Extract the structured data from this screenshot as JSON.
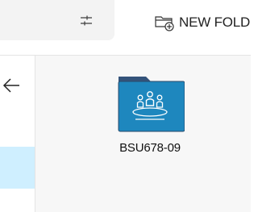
{
  "toolbar": {
    "filter_icon": "filter-sliders-icon",
    "new_folder_label": "NEW FOLD",
    "new_folder_icon": "new-folder-icon"
  },
  "nav": {
    "back_icon": "arrow-left-icon"
  },
  "files": {
    "items": [
      {
        "name": "BSU678-09",
        "type": "folder",
        "icon": "team-folder-icon",
        "color": "#1e87be"
      }
    ]
  },
  "colors": {
    "folder_tab": "#34537a",
    "folder_body": "#1e87be",
    "selection": "#cfefff",
    "content_bg": "#f7f7f7",
    "search_bg": "#f3f3f3"
  }
}
